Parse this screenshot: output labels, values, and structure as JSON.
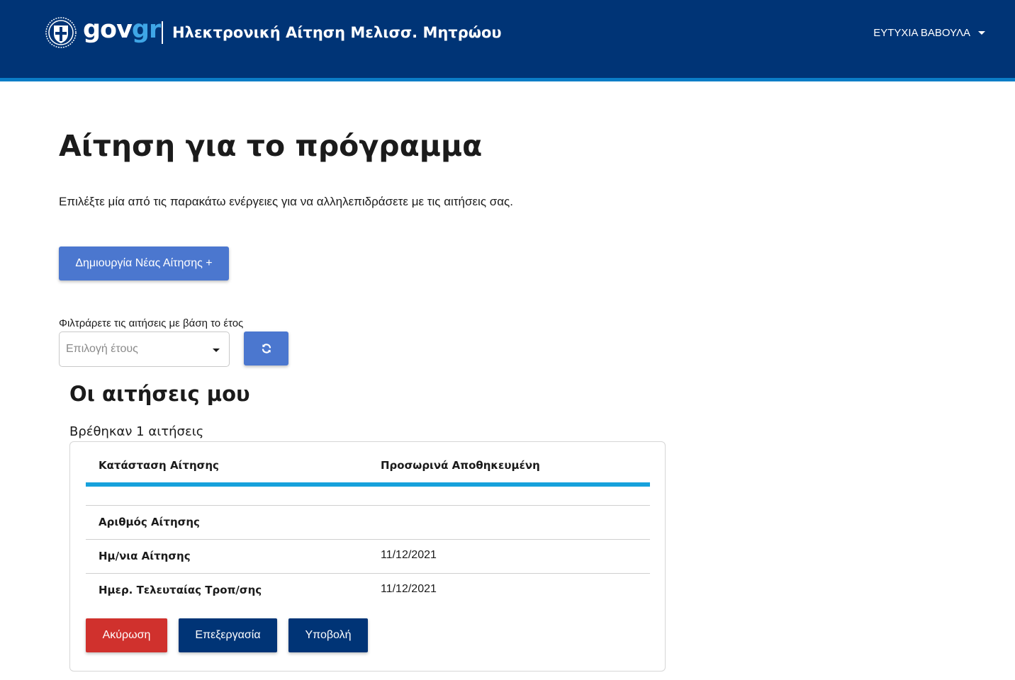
{
  "header": {
    "logo_gov": "gov",
    "logo_gr": "gr",
    "app_title": "Ηλεκτρονική Αίτηση Μελισσ. Μητρώου",
    "user_name": "ΕΥΤΥΧΙΑ ΒΑΒΟΥΛΑ",
    "colors": {
      "background": "#003476",
      "stripe": "#0b7dc7",
      "logo_accent": "#3fa6e6"
    }
  },
  "page": {
    "title": "Αίτηση για το πρόγραμμα",
    "intro": "Επιλέξτε μία από τις παρακάτω ενέργειες για να αλληλεπιδράσετε με τις αιτήσεις σας.",
    "new_application_button": "Δημιουργία Νέας Αίτησης +"
  },
  "filter": {
    "label": "Φιλτράρετε τις αιτήσεις με βάση το έτος",
    "year_placeholder": "Επιλογή έτους",
    "refresh_icon": "refresh-icon"
  },
  "applications": {
    "section_title": "Οι αιτήσεις μου",
    "found_text": "Βρέθηκαν 1 αιτήσεις",
    "card": {
      "status_label": "Κατάσταση Αίτησης",
      "status_value": "Προσωρινά Αποθηκευμένη",
      "rows": [
        {
          "label": "Αριθμός Αίτησης",
          "value": ""
        },
        {
          "label": "Ημ/νια Αίτησης",
          "value": "11/12/2021"
        },
        {
          "label": "Ημερ. Τελευταίας Τροπ/σης",
          "value": "11/12/2021"
        }
      ],
      "actions": {
        "cancel": "Ακύρωση",
        "edit": "Επεξεργασία",
        "submit": "Υποβολή"
      }
    }
  },
  "colors": {
    "primary_button": "#4b77cf",
    "danger": "#d0312d",
    "dark_blue": "#003476",
    "accent_bar": "#17a1dc"
  }
}
